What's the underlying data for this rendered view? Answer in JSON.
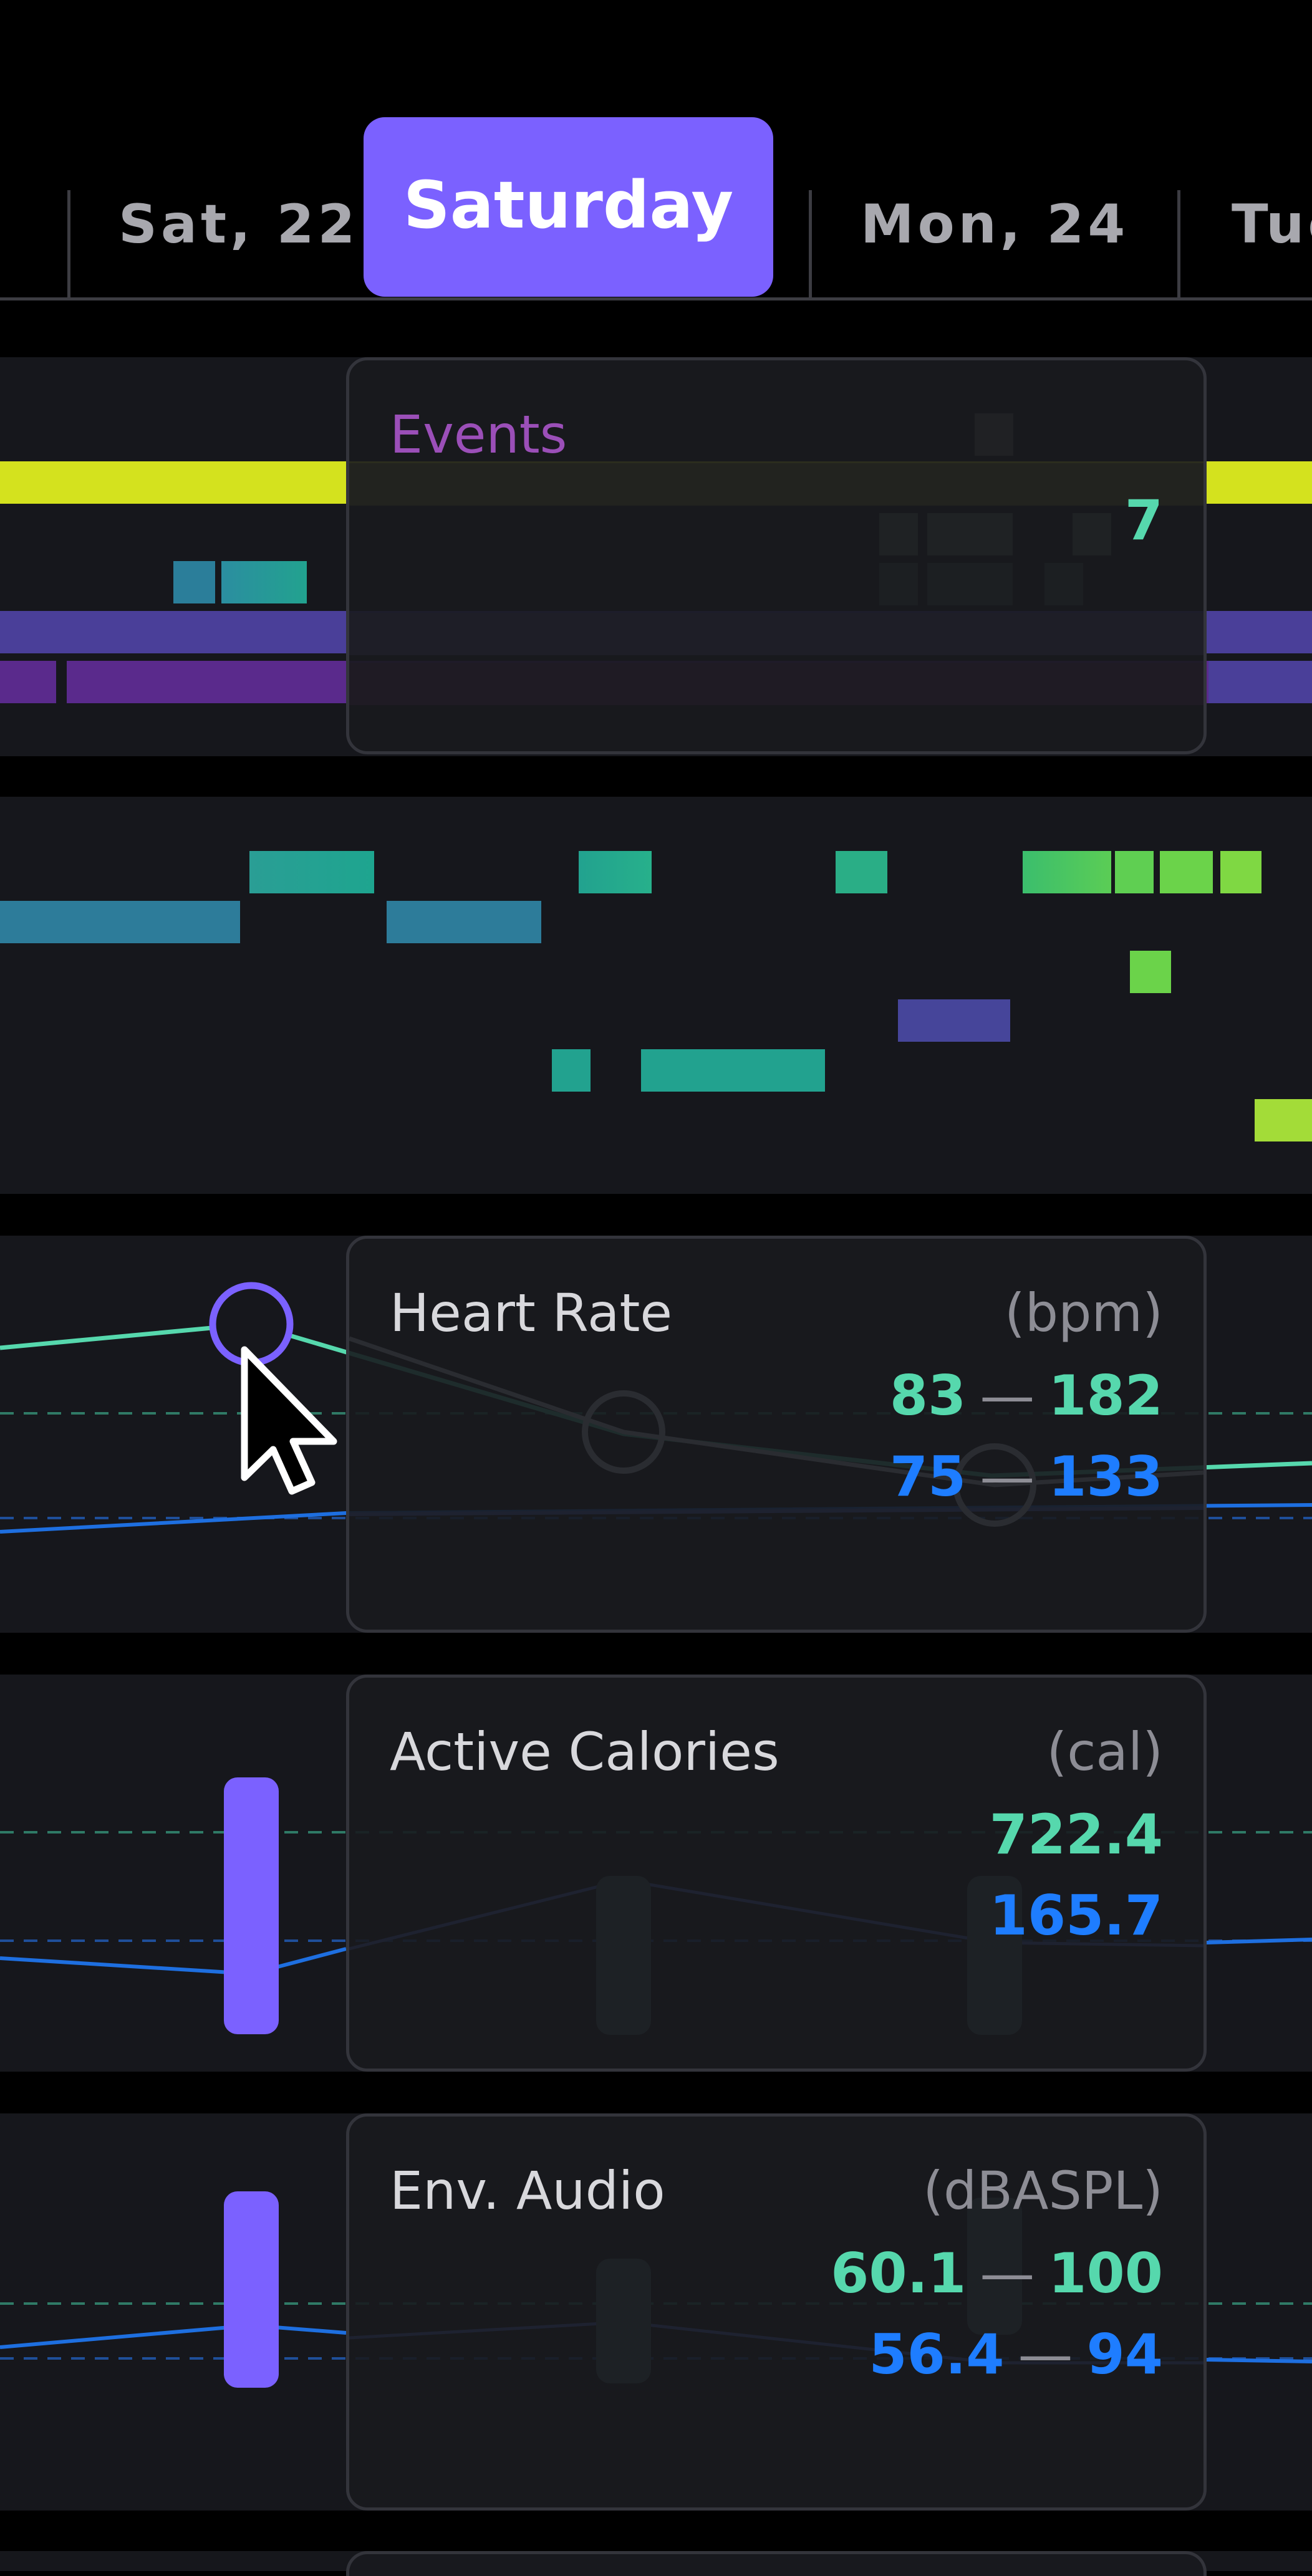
{
  "days": {
    "prev": "Sat, 22",
    "selected": "Saturday",
    "next": "Mon, 24",
    "partial": "Tue"
  },
  "events_tooltip": {
    "title": "Events",
    "count": "7"
  },
  "heart_rate_tooltip": {
    "title": "Heart Rate",
    "unit": "(bpm)",
    "range1_low": "83",
    "range1_high": "182",
    "range2_low": "75",
    "range2_high": "133",
    "separator": "—"
  },
  "calories_tooltip": {
    "title": "Active Calories",
    "unit": "(cal)",
    "value1": "722.4",
    "value2": "165.7"
  },
  "audio_tooltip": {
    "title": "Env. Audio",
    "unit": "(dBASPL)",
    "range1_low": "60.1",
    "range1_high": "100",
    "range2_low": "56.4",
    "range2_high": "94",
    "separator": "—"
  },
  "colors": {
    "accent": "#7b61ff",
    "teal": "#56d8ad",
    "blue": "#1e7dff",
    "lime": "#d4e21e",
    "purple": "#5a2a8c",
    "indigo": "#4a3f99",
    "green": "#6bd34a"
  },
  "icons": {
    "cursor": "mouse-pointer-icon",
    "hover_marker": "circle-marker-icon"
  }
}
